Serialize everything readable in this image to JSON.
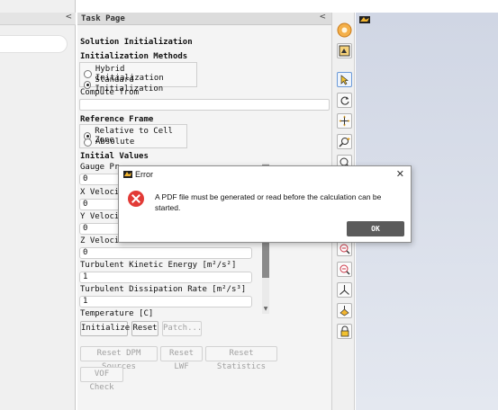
{
  "task_page": {
    "header": "Task Page",
    "title": "Solution Initialization",
    "init_methods": {
      "heading": "Initialization Methods",
      "options": [
        "Hybrid  Initialization",
        "Standard Initialization"
      ]
    },
    "compute_from_label": "Compute from",
    "compute_from_value": "",
    "reference_frame": {
      "heading": "Reference Frame",
      "options": [
        "Relative to Cell Zone",
        "Absolute"
      ]
    },
    "initial_values": {
      "heading": "Initial Values",
      "fields": [
        {
          "label": "Gauge Pr",
          "value": "0"
        },
        {
          "label": "X Veloci",
          "value": "0"
        },
        {
          "label": "Y Veloci",
          "value": "0"
        },
        {
          "label": "Z Veloci",
          "value": "0"
        },
        {
          "label": "Turbulent Kinetic Energy [m²/s²]",
          "value": "1"
        },
        {
          "label": "Turbulent Dissipation Rate [m²/s³]",
          "value": "1"
        },
        {
          "label": "Temperature [C]",
          "value": ""
        }
      ]
    },
    "buttons": {
      "initialize": "Initialize",
      "reset": "Reset",
      "patch": "Patch...",
      "reset_dpm": "Reset DPM Sources",
      "reset_lwf": "Reset LWF",
      "reset_stats": "Reset Statistics",
      "vof_check": "VOF Check"
    }
  },
  "error_dialog": {
    "title": "Error",
    "message": "A PDF file must be generated or read before the calculation can be started.",
    "ok_label": "OK"
  },
  "chevrons": {
    "collapse": "<"
  },
  "colors": {
    "error_icon": "#e23a36",
    "ok_button": "#5b5b5b",
    "accent": "#6b9ad8"
  }
}
